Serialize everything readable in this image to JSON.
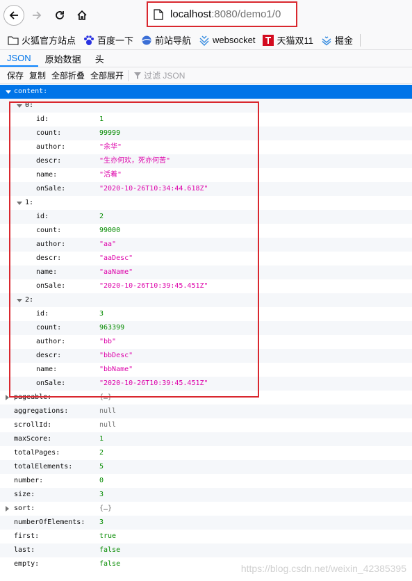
{
  "browser": {
    "url_host": "localhost",
    "url_rest": ":8080/demo1/0"
  },
  "bookmarks": [
    {
      "label": "火狐官方站点",
      "icon": "folder-icon"
    },
    {
      "label": "百度一下",
      "icon": "baidu-paw-icon"
    },
    {
      "label": "前站导航",
      "icon": "globe-icon"
    },
    {
      "label": "websocket",
      "icon": "websocket-icon"
    },
    {
      "label": "天猫双11",
      "icon": "tmall-icon"
    },
    {
      "label": "掘金",
      "icon": "juejin-icon"
    }
  ],
  "tabs": [
    "JSON",
    "原始数据",
    "头"
  ],
  "toolbar": {
    "save": "保存",
    "copy": "复制",
    "collapse_all": "全部折叠",
    "expand_all": "全部展开",
    "filter_placeholder": "过滤 JSON"
  },
  "tree": {
    "content_key": "content:",
    "items": [
      {
        "index": "0:",
        "fields": [
          {
            "k": "id:",
            "v": "1",
            "t": "num"
          },
          {
            "k": "count:",
            "v": "99999",
            "t": "num"
          },
          {
            "k": "author:",
            "v": "\"余华\"",
            "t": "str"
          },
          {
            "k": "descr:",
            "v": "\"生亦何欢，死亦何苦\"",
            "t": "str"
          },
          {
            "k": "name:",
            "v": "\"活着\"",
            "t": "str"
          },
          {
            "k": "onSale:",
            "v": "\"2020-10-26T10:34:44.618Z\"",
            "t": "str"
          }
        ]
      },
      {
        "index": "1:",
        "fields": [
          {
            "k": "id:",
            "v": "2",
            "t": "num"
          },
          {
            "k": "count:",
            "v": "99000",
            "t": "num"
          },
          {
            "k": "author:",
            "v": "\"aa\"",
            "t": "str"
          },
          {
            "k": "descr:",
            "v": "\"aaDesc\"",
            "t": "str"
          },
          {
            "k": "name:",
            "v": "\"aaName\"",
            "t": "str"
          },
          {
            "k": "onSale:",
            "v": "\"2020-10-26T10:39:45.451Z\"",
            "t": "str"
          }
        ]
      },
      {
        "index": "2:",
        "fields": [
          {
            "k": "id:",
            "v": "3",
            "t": "num"
          },
          {
            "k": "count:",
            "v": "963399",
            "t": "num"
          },
          {
            "k": "author:",
            "v": "\"bb\"",
            "t": "str"
          },
          {
            "k": "descr:",
            "v": "\"bbDesc\"",
            "t": "str"
          },
          {
            "k": "name:",
            "v": "\"bbName\"",
            "t": "str"
          },
          {
            "k": "onSale:",
            "v": "\"2020-10-26T10:39:45.451Z\"",
            "t": "str"
          }
        ]
      }
    ],
    "top_level": [
      {
        "k": "pageable:",
        "v": "{…}",
        "t": "obj",
        "collapsed": true
      },
      {
        "k": "aggregations:",
        "v": "null",
        "t": "null"
      },
      {
        "k": "scrollId:",
        "v": "null",
        "t": "null"
      },
      {
        "k": "maxScore:",
        "v": "1",
        "t": "num"
      },
      {
        "k": "totalPages:",
        "v": "2",
        "t": "num"
      },
      {
        "k": "totalElements:",
        "v": "5",
        "t": "num"
      },
      {
        "k": "number:",
        "v": "0",
        "t": "num"
      },
      {
        "k": "size:",
        "v": "3",
        "t": "num"
      },
      {
        "k": "sort:",
        "v": "{…}",
        "t": "obj",
        "collapsed": true
      },
      {
        "k": "numberOfElements:",
        "v": "3",
        "t": "num"
      },
      {
        "k": "first:",
        "v": "true",
        "t": "bool"
      },
      {
        "k": "last:",
        "v": "false",
        "t": "bool"
      },
      {
        "k": "empty:",
        "v": "false",
        "t": "bool"
      }
    ]
  },
  "watermark": "https://blog.csdn.net/weixin_42385395"
}
